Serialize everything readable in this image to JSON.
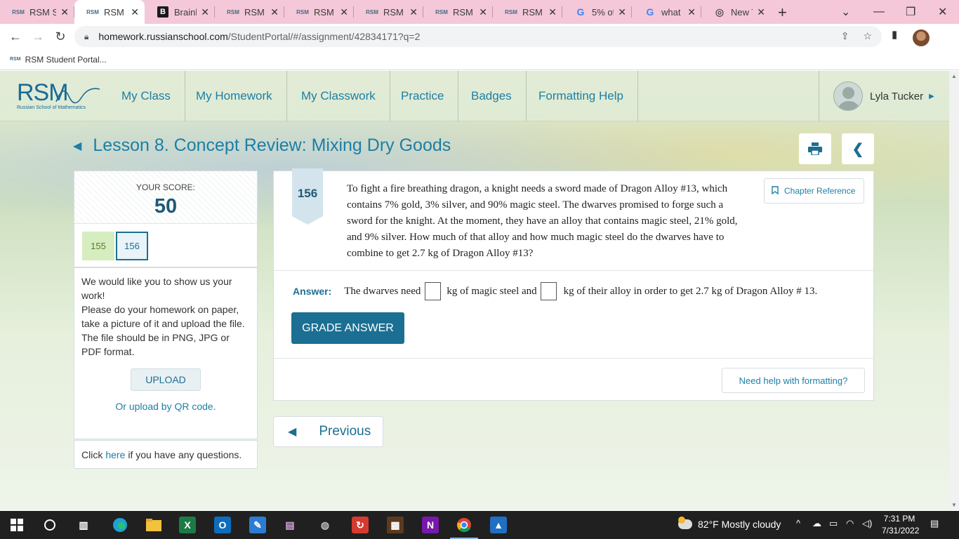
{
  "browser": {
    "tabs": [
      {
        "title": "RSM S",
        "icon": "rsm",
        "active": false
      },
      {
        "title": "RSM S",
        "icon": "rsm",
        "active": true
      },
      {
        "title": "Brainly",
        "icon": "brainly",
        "active": false
      },
      {
        "title": "RSM S",
        "icon": "rsm",
        "active": false
      },
      {
        "title": "RSM S",
        "icon": "rsm",
        "active": false
      },
      {
        "title": "RSM S",
        "icon": "rsm",
        "active": false
      },
      {
        "title": "RSM S",
        "icon": "rsm",
        "active": false
      },
      {
        "title": "RSM S",
        "icon": "rsm",
        "active": false
      },
      {
        "title": "5% of",
        "icon": "google",
        "active": false
      },
      {
        "title": "what is",
        "icon": "google",
        "active": false
      },
      {
        "title": "New T",
        "icon": "chrome",
        "active": false
      }
    ],
    "url_host": "homework.russianschool.com",
    "url_path": "/StudentPortal/#/assignment/42834171?q=2",
    "bookmark": "RSM Student Portal...",
    "rsm_favicon": "RSM"
  },
  "site": {
    "logo_text": "RSM",
    "logo_sub": "Russian School of Mathematics",
    "nav": [
      "My Class",
      "My Homework",
      "My Classwork",
      "Practice",
      "Badges",
      "Formatting Help"
    ],
    "user_name": "Lyla Tucker"
  },
  "lesson": {
    "title": "Lesson 8. Concept Review: Mixing Dry Goods"
  },
  "score": {
    "label": "YOUR SCORE:",
    "value": "50",
    "questions": [
      "155",
      "156"
    ],
    "current": "156"
  },
  "work": {
    "p1": "We would like you to show us your work!",
    "p2": "Please do your homework on paper, take a picture of it and upload the file.",
    "p3": "The file should be in PNG, JPG or PDF format.",
    "upload_label": "UPLOAD",
    "qr_link": "Or upload by QR code."
  },
  "help": {
    "before": "Click",
    "link": "here",
    "after": "if you have any questions."
  },
  "question": {
    "number": "156",
    "text": "To fight a fire breathing dragon, a knight needs a sword made of Dragon Alloy #13, which contains 7% gold, 3% silver, and 90% magic steel. The dwarves promised to forge such a sword for the knight. At the moment, they have an alloy that contains magic steel, 21% gold, and 9% silver.  How much of that alloy and how much magic steel do the dwarves have to combine to get 2.7 kg of Dragon Alloy #13?",
    "chapter_ref": "Chapter Reference",
    "answer_label": "Answer:",
    "answer_part1": "The dwarves need",
    "answer_part2": "kg of magic steel and",
    "answer_part3": "kg of their alloy in order to get 2.7 kg of Dragon Alloy # 13.",
    "grade_label": "GRADE ANSWER",
    "formatting_help": "Need help with formatting?"
  },
  "pager": {
    "previous": "Previous"
  },
  "taskbar": {
    "weather_temp": "82°F",
    "weather_text": "Mostly cloudy",
    "time": "7:31 PM",
    "date": "7/31/2022"
  }
}
